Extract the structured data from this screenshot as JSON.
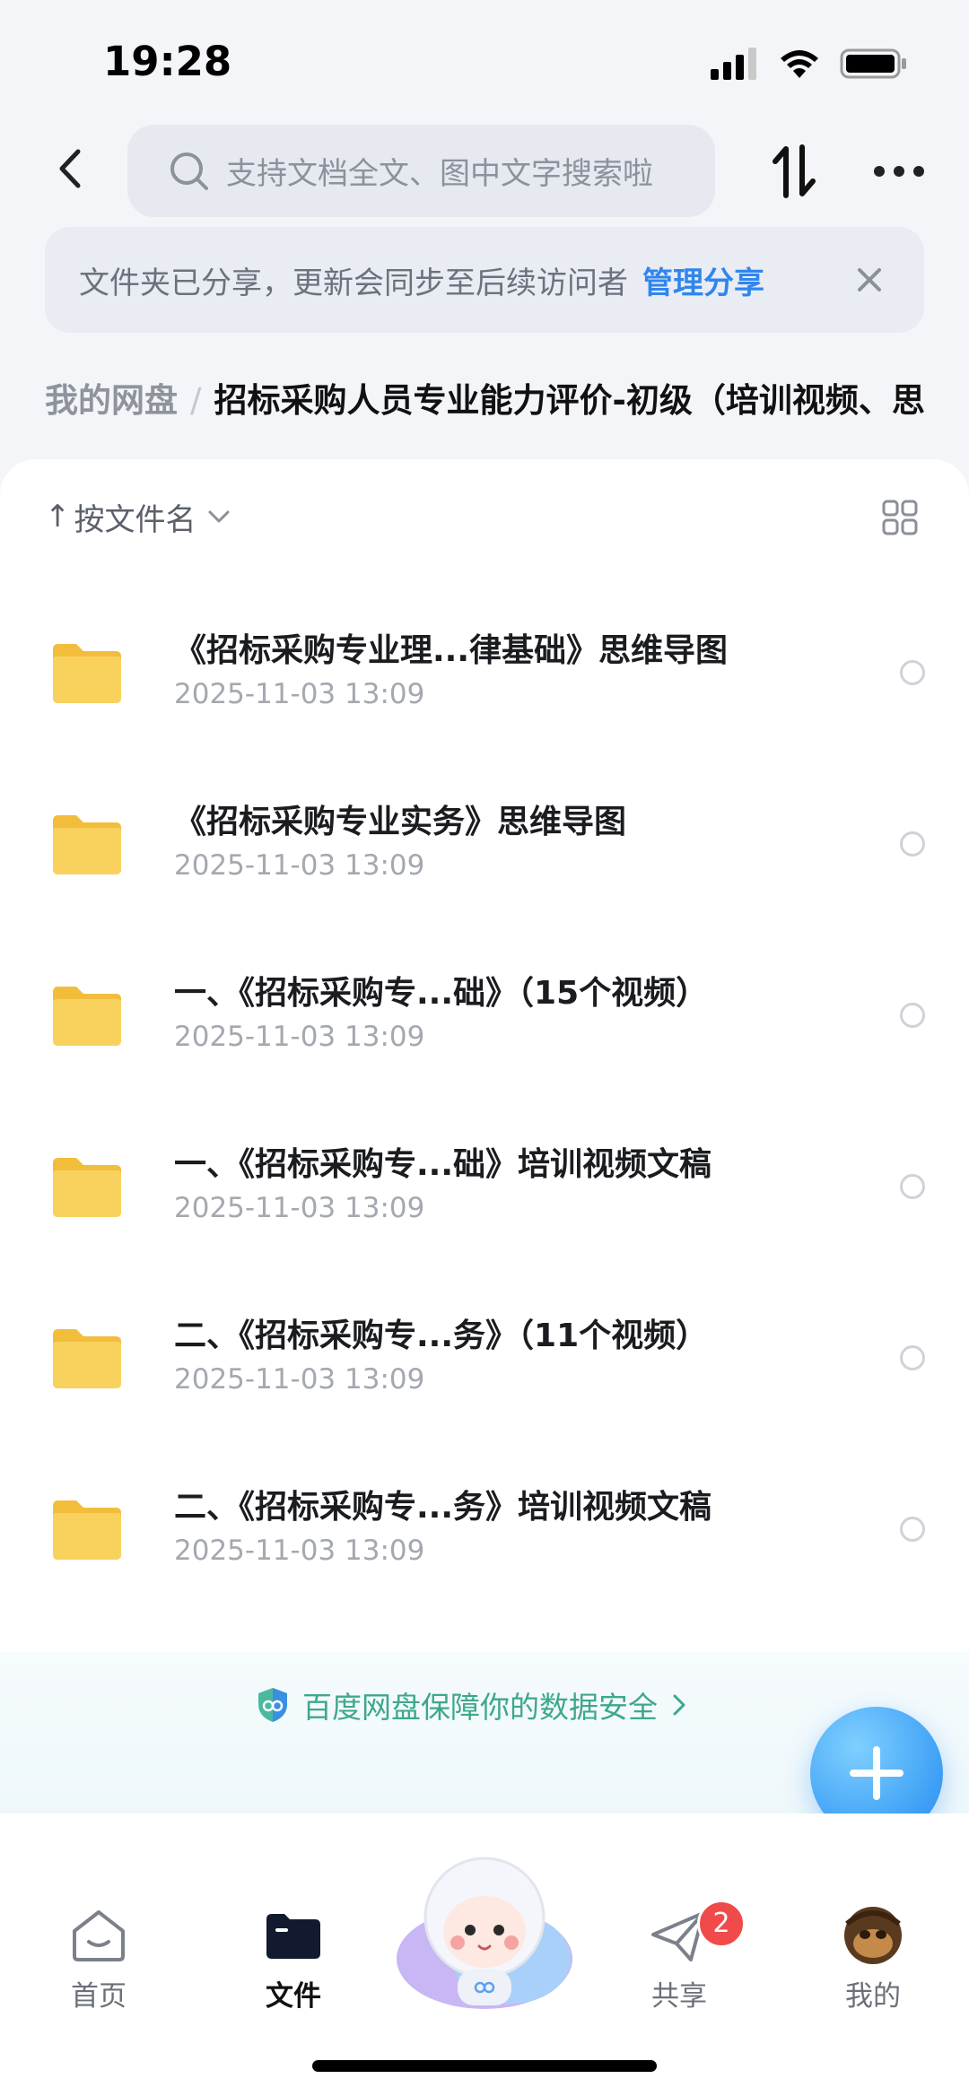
{
  "status_bar": {
    "time": "19:28"
  },
  "search": {
    "placeholder": "支持文档全文、图中文字搜索啦"
  },
  "share_banner": {
    "message": "文件夹已分享，更新会同步至后续访问者",
    "manage_link": "管理分享"
  },
  "breadcrumb": {
    "root": "我的网盘",
    "separator": "/",
    "current": "招标采购人员专业能力评价-初级（培训视频、思"
  },
  "sort": {
    "label": "按文件名",
    "arrow": "↑"
  },
  "files": [
    {
      "name": "《招标采购专业理...律基础》思维导图",
      "date": "2025-11-03 13:09"
    },
    {
      "name": "《招标采购专业实务》思维导图",
      "date": "2025-11-03 13:09"
    },
    {
      "name": "一、《招标采购专...础》（15个视频）",
      "date": "2025-11-03 13:09"
    },
    {
      "name": "一、《招标采购专...础》培训视频文稿",
      "date": "2025-11-03 13:09"
    },
    {
      "name": "二、《招标采购专...务》（11个视频）",
      "date": "2025-11-03 13:09"
    },
    {
      "name": "二、《招标采购专...务》培训视频文稿",
      "date": "2025-11-03 13:09"
    }
  ],
  "security": {
    "text": "百度网盘保障你的数据安全"
  },
  "tabs": [
    {
      "label": "首页",
      "icon": "home-icon"
    },
    {
      "label": "文件",
      "icon": "folder-icon",
      "active": true
    },
    {
      "label": "",
      "icon": "mascot-icon"
    },
    {
      "label": "共享",
      "icon": "share-plane-icon",
      "badge": "2"
    },
    {
      "label": "我的",
      "icon": "avatar"
    }
  ],
  "colors": {
    "accent": "#2f86ee",
    "folder": "#f8cf52",
    "security_green": "#3ea88a",
    "badge_red": "#f04a4a"
  }
}
